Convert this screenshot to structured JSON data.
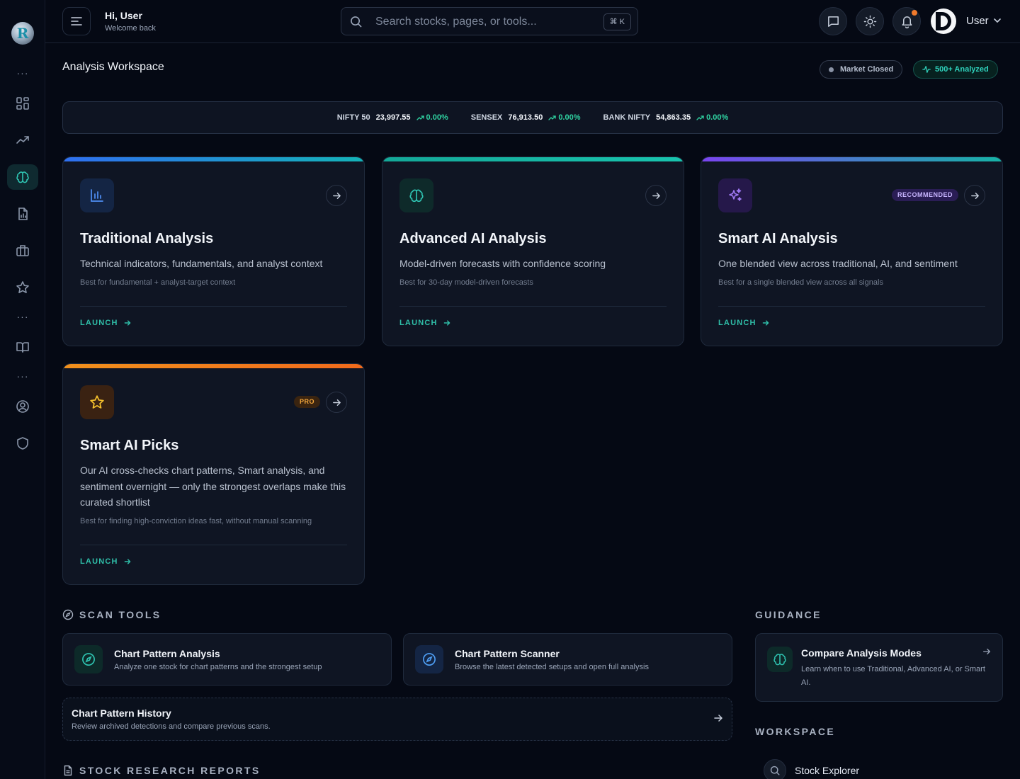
{
  "brand": {
    "logo_letter": "R"
  },
  "sidebar": {
    "items": [
      {
        "name": "dashboard",
        "icon": "grid-icon"
      },
      {
        "name": "trends",
        "icon": "trending-up-icon"
      },
      {
        "name": "analysis",
        "icon": "brain-icon",
        "active": true
      },
      {
        "name": "reports",
        "icon": "file-chart-icon"
      },
      {
        "name": "portfolio",
        "icon": "briefcase-icon"
      },
      {
        "name": "watchlist",
        "icon": "star-icon"
      },
      {
        "name": "learn",
        "icon": "book-icon"
      },
      {
        "name": "account",
        "icon": "user-circle-icon"
      },
      {
        "name": "security",
        "icon": "shield-icon"
      }
    ],
    "dots": "···"
  },
  "header": {
    "greeting": "Hi, User",
    "subgreeting": "Welcome back",
    "search_placeholder": "Search stocks, pages, or tools...",
    "search_shortcut": "⌘ K",
    "user_name": "User"
  },
  "page": {
    "title": "Analysis Workspace",
    "market_status": "Market Closed",
    "analyzed": "500+ Analyzed"
  },
  "ticker": [
    {
      "name": "NIFTY 50",
      "value": "23,997.55",
      "change": "0.00%"
    },
    {
      "name": "SENSEX",
      "value": "76,913.50",
      "change": "0.00%"
    },
    {
      "name": "BANK NIFTY",
      "value": "54,863.35",
      "change": "0.00%"
    }
  ],
  "cards": [
    {
      "title": "Traditional Analysis",
      "desc": "Technical indicators, fundamentals, and analyst context",
      "best": "Best for fundamental + analyst-target context",
      "launch": "LAUNCH",
      "icon": "bar-chart-icon",
      "accent": "#2f7cf0"
    },
    {
      "title": "Advanced AI Analysis",
      "desc": "Model-driven forecasts with confidence scoring",
      "best": "Best for 30-day model-driven forecasts",
      "launch": "LAUNCH",
      "icon": "brain-icon",
      "accent": "#18b5a2"
    },
    {
      "title": "Smart AI Analysis",
      "desc": "One blended view across traditional, AI, and sentiment",
      "best": "Best for a single blended view across all signals",
      "launch": "LAUNCH",
      "badge": "RECOMMENDED",
      "icon": "sparkles-icon",
      "accent": "#8a4cf0"
    },
    {
      "title": "Smart AI Picks",
      "desc": "Our AI cross-checks chart patterns, Smart analysis, and sentiment overnight — only the strongest overlaps make this curated shortlist",
      "best": "Best for finding high-conviction ideas fast, without manual scanning",
      "launch": "LAUNCH",
      "badge": "PRO",
      "icon": "star-icon",
      "accent": "#f07a1c"
    }
  ],
  "scan_tools": {
    "title": "SCAN TOOLS",
    "items": [
      {
        "title": "Chart Pattern Analysis",
        "desc": "Analyze one stock for chart patterns and the strongest setup"
      },
      {
        "title": "Chart Pattern Scanner",
        "desc": "Browse the latest detected setups and open full analysis"
      }
    ],
    "history": {
      "title": "Chart Pattern History",
      "desc": "Review archived detections and compare previous scans."
    }
  },
  "reports": {
    "title": "STOCK RESEARCH REPORTS"
  },
  "guidance": {
    "title": "GUIDANCE",
    "item": {
      "title": "Compare Analysis Modes",
      "desc": "Learn when to use Traditional, Advanced AI, or Smart AI."
    }
  },
  "workspace": {
    "title": "WORKSPACE",
    "items": [
      {
        "label": "Stock Explorer"
      }
    ]
  }
}
